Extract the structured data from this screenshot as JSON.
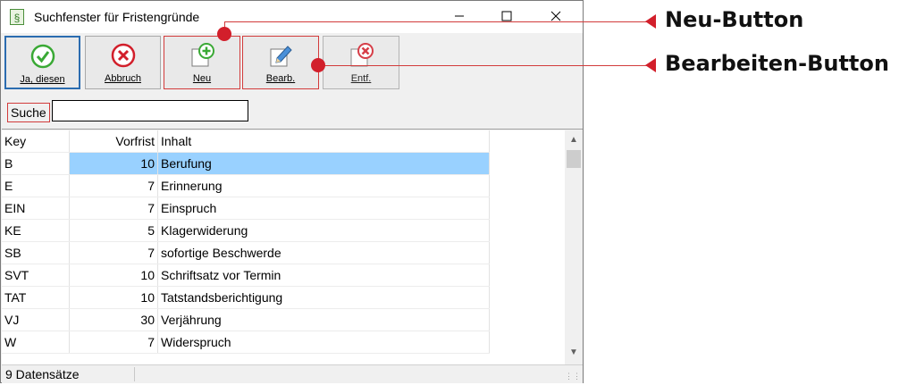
{
  "window": {
    "title": "Suchfenster für Fristengründe",
    "icon_name": "paragraph-icon",
    "icon_glyph": "§",
    "controls": [
      "minimize",
      "maximize",
      "close"
    ]
  },
  "toolbar": {
    "ja_label": "Ja, diesen",
    "abbruch_label": "Abbruch",
    "neu_label": "Neu",
    "bearb_label": "Bearb.",
    "entf_label": "Entf."
  },
  "search": {
    "label": "Suche",
    "value": ""
  },
  "table": {
    "headers": [
      "Key",
      "Vorfrist",
      "Inhalt"
    ],
    "rows": [
      [
        "B",
        "10",
        "Berufung"
      ],
      [
        "E",
        "7",
        "Erinnerung"
      ],
      [
        "EIN",
        "7",
        "Einspruch"
      ],
      [
        "KE",
        "5",
        "Klagerwiderung"
      ],
      [
        "SB",
        "7",
        "sofortige Beschwerde"
      ],
      [
        "SVT",
        "10",
        "Schriftsatz vor Termin"
      ],
      [
        "TAT",
        "10",
        "Tatstandsberichtigung"
      ],
      [
        "VJ",
        "30",
        "Verjährung"
      ],
      [
        "W",
        "7",
        "Widerspruch"
      ]
    ],
    "selected_row": 0
  },
  "status": {
    "text": "9 Datensätze"
  },
  "callouts": {
    "neu": "Neu-Button",
    "bearbeiten": "Bearbeiten-Button"
  },
  "colors": {
    "accent_red": "#d21f2b",
    "selection_blue": "#99d1ff",
    "check_green": "#3aa935"
  }
}
